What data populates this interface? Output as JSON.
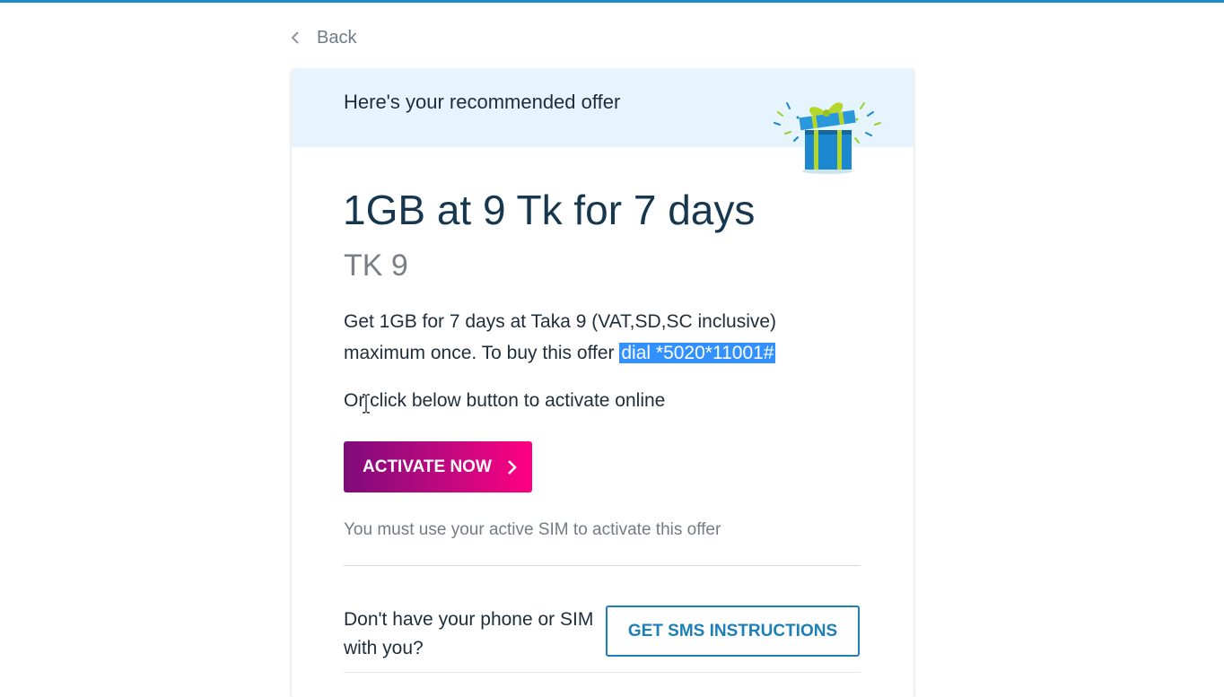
{
  "nav": {
    "back_label": "Back"
  },
  "offer_card": {
    "header_title": "Here's your recommended offer",
    "title": "1GB at 9 Tk for 7 days",
    "price": "TK 9",
    "description_prefix": "Get 1GB for 7 days at Taka 9 (VAT,SD,SC inclusive) maximum once. To buy this offer",
    "dial_code": "dial *5020*11001#",
    "or_click_text": "Or click below button to activate online",
    "activate_button_label": "ACTIVATE NOW",
    "sim_note": "You must use your active SIM to activate this offer",
    "no_phone_text": "Don't have your phone or SIM with you?",
    "sms_button_label": "GET SMS INSTRUCTIONS"
  },
  "colors": {
    "top_strip": "#1a8bc9",
    "header_bg": "#e5f4fd",
    "title_text": "#17374f",
    "selection_highlight": "#3391ff",
    "activate_gradient_start": "#7f0b7a",
    "activate_gradient_end": "#ff0080",
    "sms_button_accent": "#1c7fb5"
  },
  "icons": {
    "back": "chevron-left-icon",
    "gift": "gift-box-icon",
    "activate_arrow": "chevron-right-icon",
    "cursor": "text-cursor-icon"
  }
}
